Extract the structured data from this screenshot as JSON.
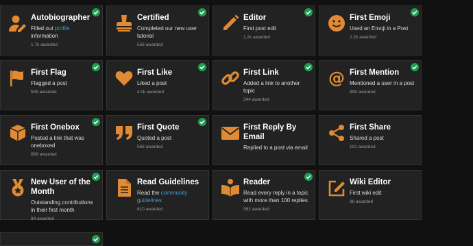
{
  "colors": {
    "icon": "#e08a34",
    "check": "#1e9e53",
    "link": "#3ba0d6",
    "card_bg": "#222222"
  },
  "badges": [
    {
      "title": "Autobiographer",
      "desc_pre": "Filled out ",
      "desc_link": "profile",
      "desc_post": " information",
      "count": "1.7k awarded",
      "icon": "user-edit-icon"
    },
    {
      "title": "Certified",
      "desc_pre": "Completed our new user tutorial",
      "desc_link": "",
      "desc_post": "",
      "count": "556 awarded",
      "icon": "stamp-icon"
    },
    {
      "title": "Editor",
      "desc_pre": "First post edit",
      "desc_link": "",
      "desc_post": "",
      "count": "1.2k awarded",
      "icon": "pencil-icon"
    },
    {
      "title": "First Emoji",
      "desc_pre": "Used an Emoji in a Post",
      "desc_link": "",
      "desc_post": "",
      "count": "2.2k awarded",
      "icon": "smile-icon"
    },
    {
      "title": "First Flag",
      "desc_pre": "Flagged a post",
      "desc_link": "",
      "desc_post": "",
      "count": "549 awarded",
      "icon": "flag-icon"
    },
    {
      "title": "First Like",
      "desc_pre": "Liked a post",
      "desc_link": "",
      "desc_post": "",
      "count": "4.0k awarded",
      "icon": "heart-icon"
    },
    {
      "title": "First Link",
      "desc_pre": "Added a link to another topic",
      "desc_link": "",
      "desc_post": "",
      "count": "344 awarded",
      "icon": "link-icon"
    },
    {
      "title": "First Mention",
      "desc_pre": "Mentioned a user in a post",
      "desc_link": "",
      "desc_post": "",
      "count": "899 awarded",
      "icon": "at-icon"
    },
    {
      "title": "First Onebox",
      "desc_pre": "Posted a link that was oneboxed",
      "desc_link": "",
      "desc_post": "",
      "count": "668 awarded",
      "icon": "cube-icon"
    },
    {
      "title": "First Quote",
      "desc_pre": "Quoted a post",
      "desc_link": "",
      "desc_post": "",
      "count": "566 awarded",
      "icon": "quote-icon"
    },
    {
      "title": "First Reply By Email",
      "desc_pre": "Replied to a post via email",
      "desc_link": "",
      "desc_post": "",
      "count": "",
      "icon": "envelope-icon"
    },
    {
      "title": "First Share",
      "desc_pre": "Shared a post",
      "desc_link": "",
      "desc_post": "",
      "count": "191 awarded",
      "icon": "share-icon"
    },
    {
      "title": "New User of the Month",
      "desc_pre": "Outstanding contributions in their first month",
      "desc_link": "",
      "desc_post": "",
      "count": "84 awarded",
      "icon": "medal-icon"
    },
    {
      "title": "Read Guidelines",
      "desc_pre": "Read the ",
      "desc_link": "community guidelines",
      "desc_post": "",
      "count": "810 awarded",
      "icon": "file-text-icon"
    },
    {
      "title": "Reader",
      "desc_pre": "Read every reply in a topic with more than 100 replies",
      "desc_link": "",
      "desc_post": "",
      "count": "582 awarded",
      "icon": "book-icon"
    },
    {
      "title": "Wiki Editor",
      "desc_pre": "First wiki edit",
      "desc_link": "",
      "desc_post": "",
      "count": "98 awarded",
      "icon": "edit-box-icon"
    }
  ]
}
